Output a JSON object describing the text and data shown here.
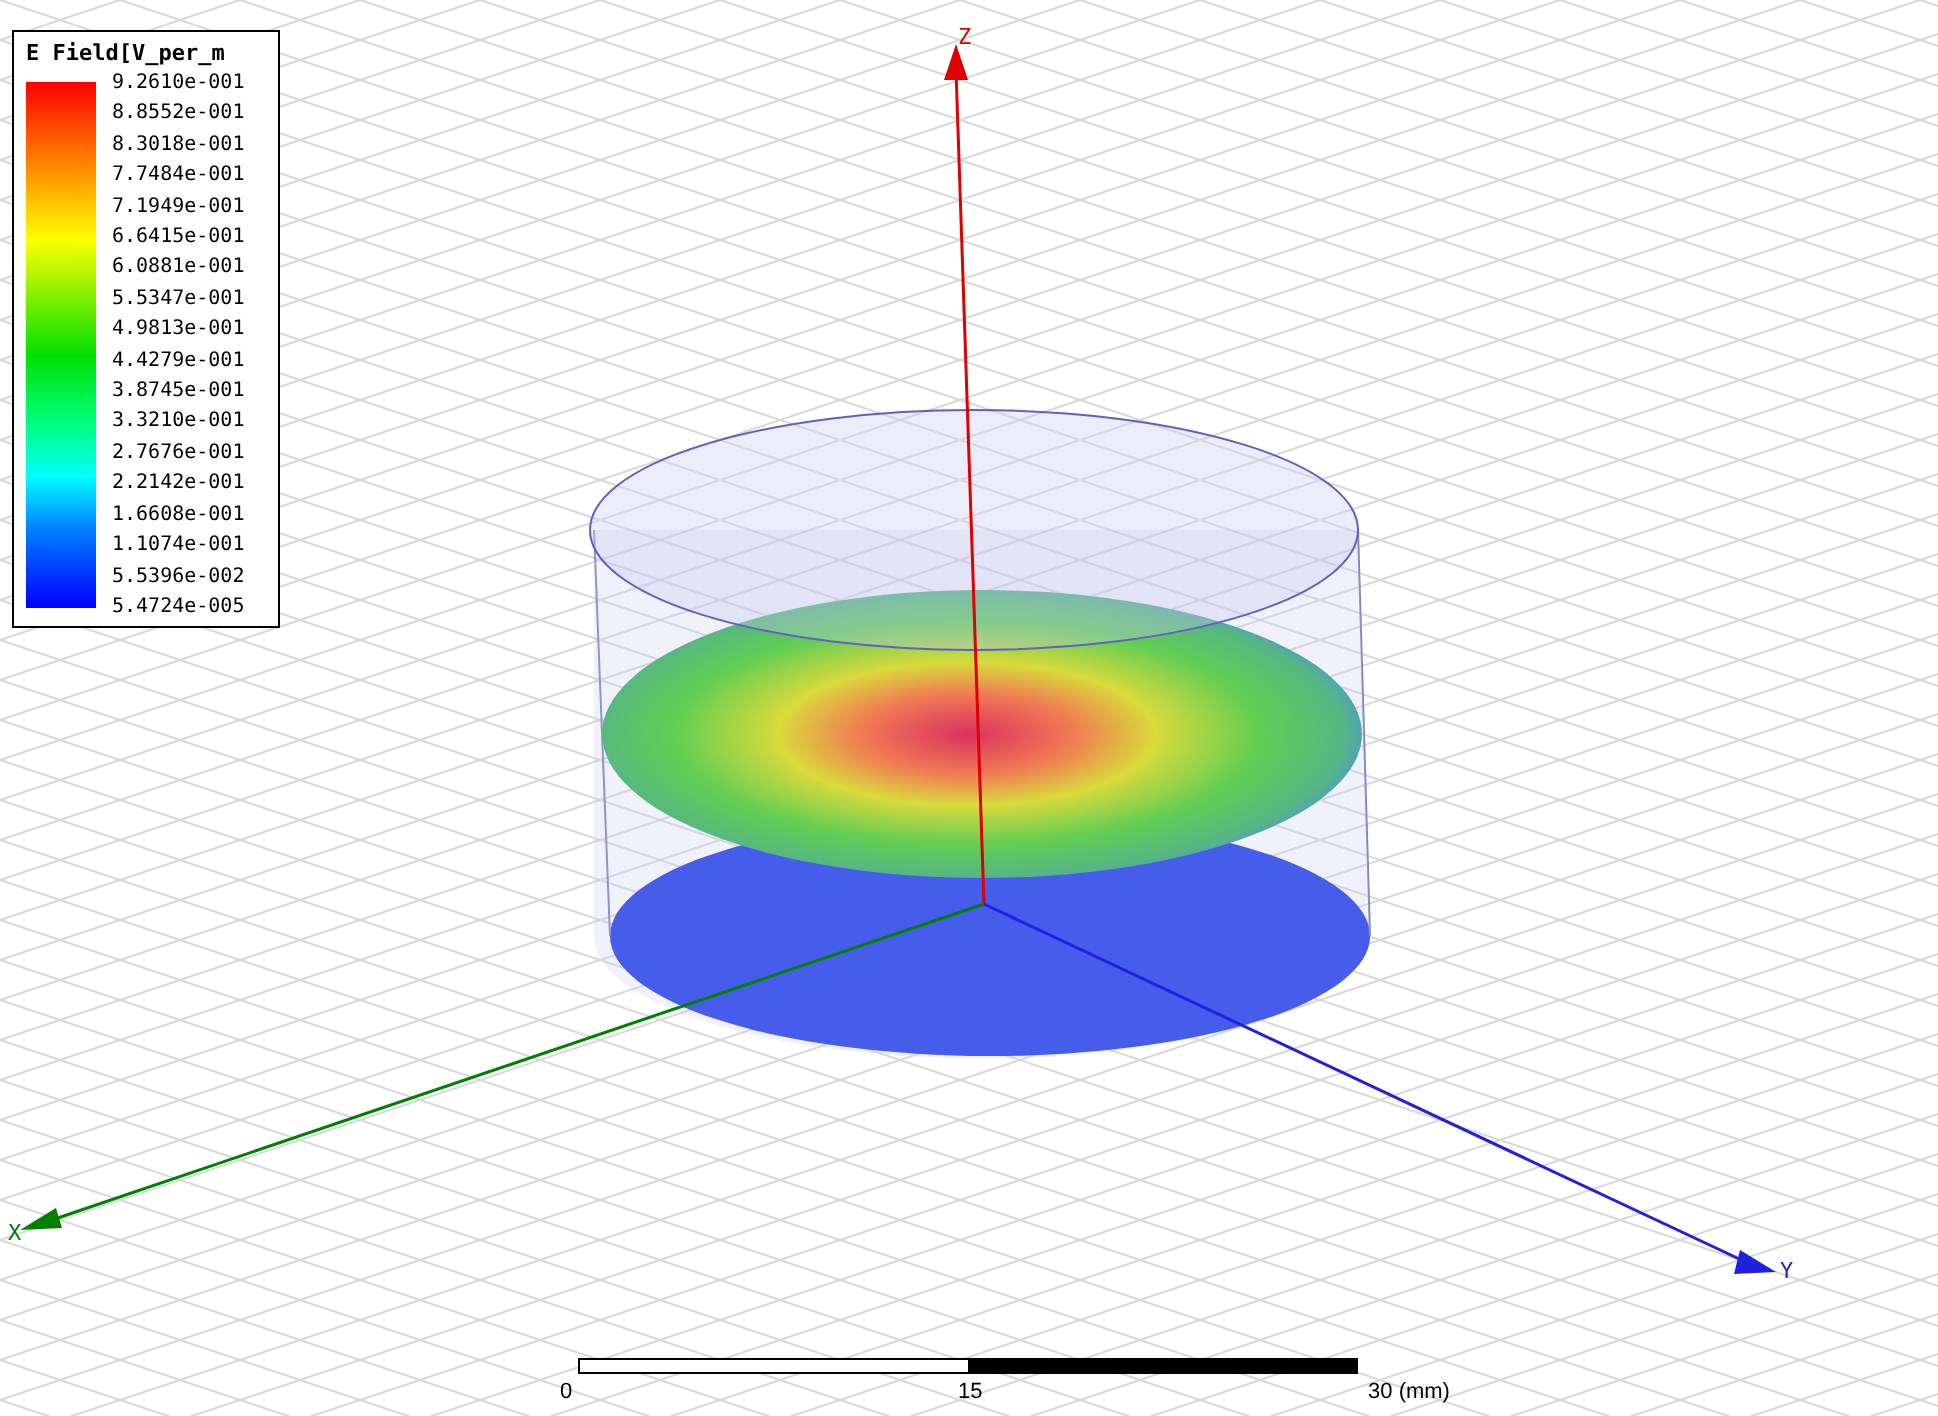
{
  "legend": {
    "title": "E Field[V_per_m",
    "values": [
      "9.2610e-001",
      "8.8552e-001",
      "8.3018e-001",
      "7.7484e-001",
      "7.1949e-001",
      "6.6415e-001",
      "6.0881e-001",
      "5.5347e-001",
      "4.9813e-001",
      "4.4279e-001",
      "3.8745e-001",
      "3.3210e-001",
      "2.7676e-001",
      "2.2142e-001",
      "1.6608e-001",
      "1.1074e-001",
      "5.5396e-002",
      "5.4724e-005"
    ]
  },
  "axes": [
    {
      "kind": "z",
      "label": "Z"
    },
    {
      "kind": "x",
      "label": "X"
    },
    {
      "kind": "y",
      "label": "Y"
    }
  ],
  "scale_bar": {
    "labels": [
      "0",
      "15",
      "30 (mm)"
    ]
  }
}
